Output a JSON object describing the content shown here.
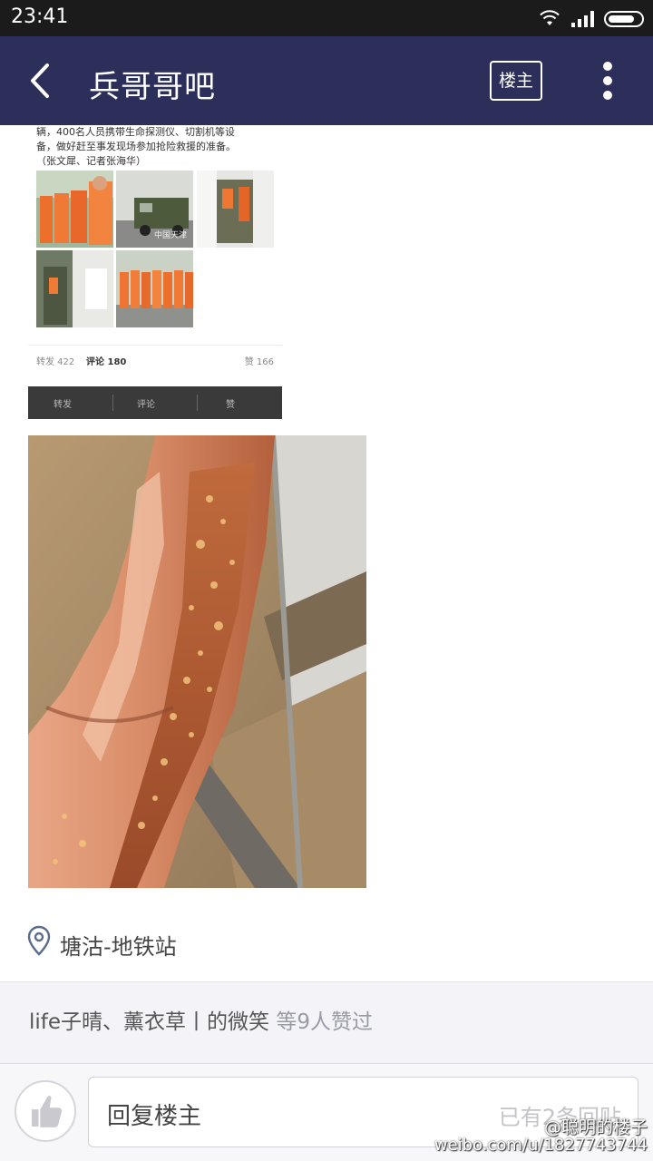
{
  "status_bar": {
    "time": "23:41"
  },
  "nav": {
    "title": "兵哥哥吧",
    "owner_button": "楼主"
  },
  "embedded_post": {
    "text_lines": [
      "辆，400名人员携带生命探测仪、切割机等设",
      "备，做好赶至事发现场参加抢险救援的准备。",
      "（张文犀、记者张海华）"
    ],
    "watermark": "中国天津",
    "counts": {
      "repost": "转发 422",
      "comment": "评论 180",
      "like": "赞 166"
    },
    "actions": {
      "repost": "转发",
      "comment": "评论",
      "like": "赞"
    }
  },
  "location": {
    "icon": "location-pin-icon",
    "text": "塘沽-地铁站"
  },
  "likes": {
    "names": "life子晴、薰衣草丨的微笑",
    "count": "等9人赞过"
  },
  "reply_bar": {
    "like_icon": "thumbs-up-icon",
    "placeholder": "回复楼主",
    "reply_count": "已有2条回贴"
  },
  "watermark": {
    "handle": "@聪明的楼子",
    "url": "weibo.com/u/1827743744"
  },
  "colors": {
    "nav_bg": "#2b2f5a",
    "status_bg": "#1b1b1b",
    "likes_bg": "#f3f3f8"
  }
}
